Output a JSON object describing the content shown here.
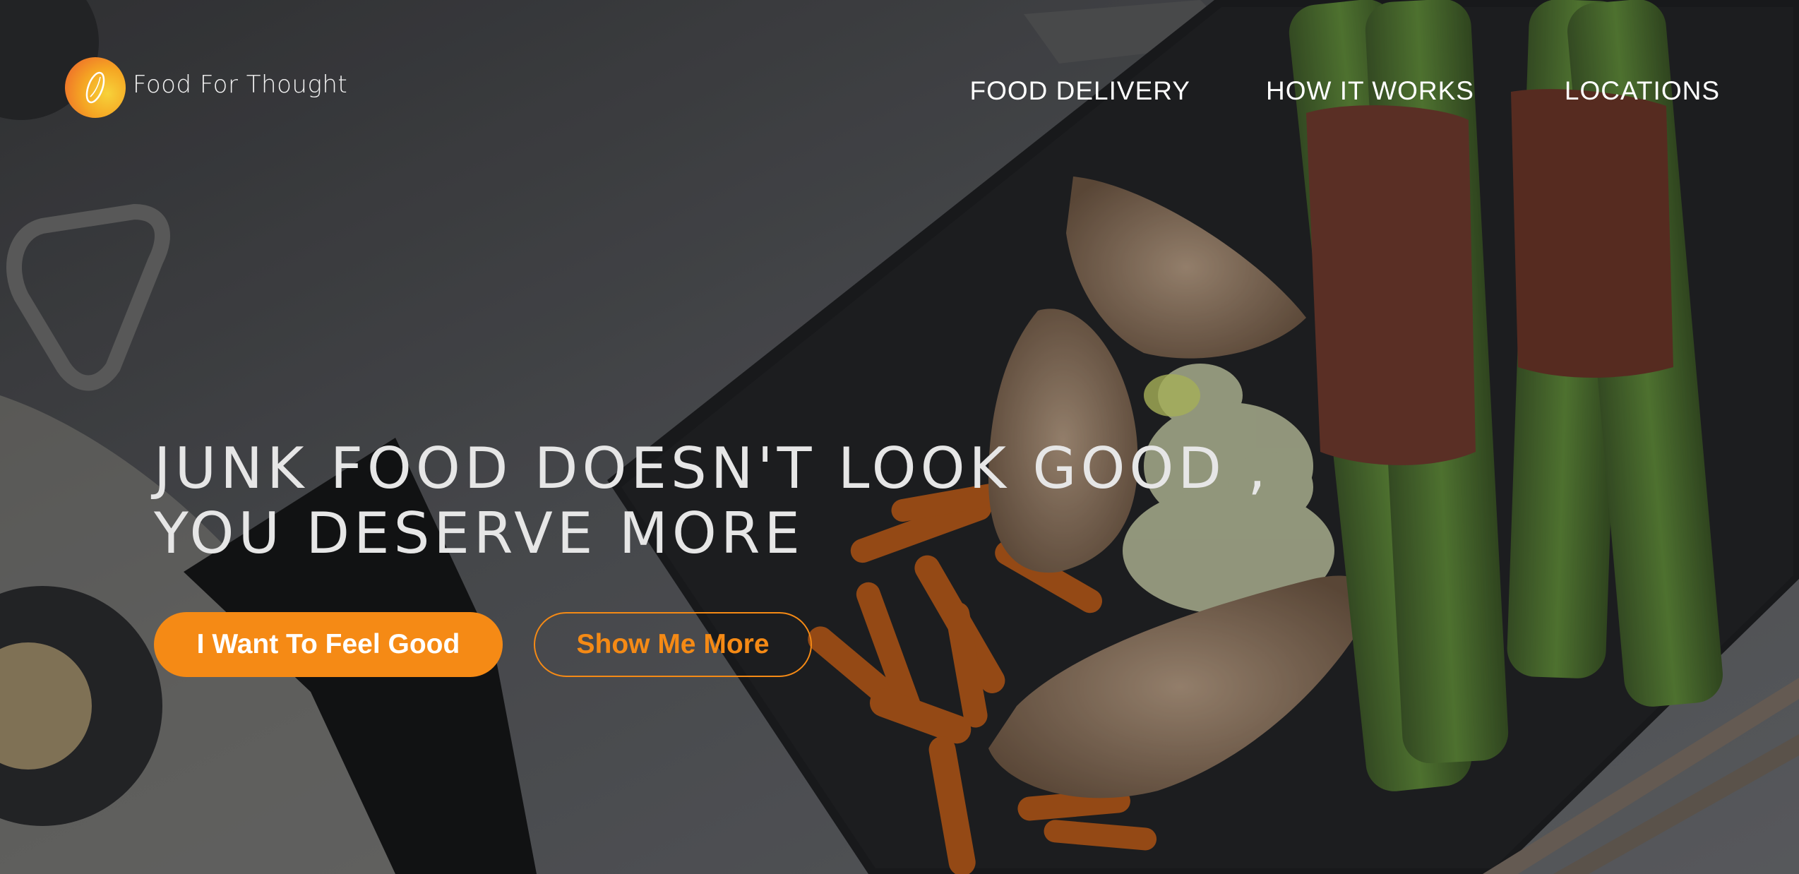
{
  "brand": {
    "name": "Food For Thought",
    "accent": "#f58a15"
  },
  "nav": {
    "items": [
      {
        "label": "FOOD DELIVERY"
      },
      {
        "label": "HOW IT WORKS"
      },
      {
        "label": "LOCATIONS"
      }
    ]
  },
  "hero": {
    "headline_line1": "JUNK FOOD DOESN'T LOOK GOOD ,",
    "headline_line2": "YOU DESERVE MORE",
    "primary_cta": "I Want To Feel Good",
    "secondary_cta": "Show Me More"
  }
}
